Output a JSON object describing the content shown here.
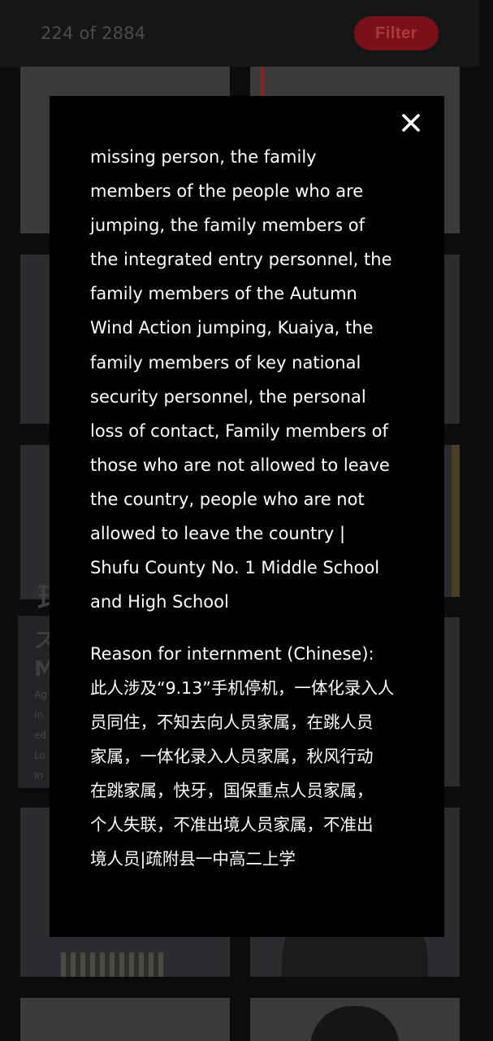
{
  "header": {
    "counter": "224 of 2884",
    "filter_label": "Filter"
  },
  "background": {
    "info_card": {
      "title": "玛",
      "letters": [
        "ス",
        "M"
      ],
      "lines": [
        "Ag",
        "In",
        "ed",
        "Lo",
        "In"
      ]
    }
  },
  "modal": {
    "close_icon": "close-icon",
    "description_english": "missing person, the family\nmembers of the people who are\njumping, the family members of\nthe integrated entry personnel, the\nfamily members of the Autumn\nWind Action jumping, Kuaiya, the\nfamily members of key national\nsecurity personnel, the personal\nloss of contact, Family members of\nthose who are not allowed to leave\nthe country, people who are not\nallowed to leave the country |\nShufu County No. 1 Middle School\nand High School",
    "reason_label": "Reason for internment (Chinese):",
    "description_chinese": "此人涉及“9.13”手机停机，一体化录入人\n员同住，不知去向人员家属，在跳人员\n家属，一体化录入人员家属，秋风行动\n在跳家属，快牙，国保重点人员家属，\n个人失联，不准出境人员家属，不准出\n境人员|疏附县一中高二上学"
  },
  "colors": {
    "filter_bg": "#7a1118",
    "filter_text": "#a83a40",
    "modal_bg": "#000000",
    "modal_text": "#ffffff"
  }
}
